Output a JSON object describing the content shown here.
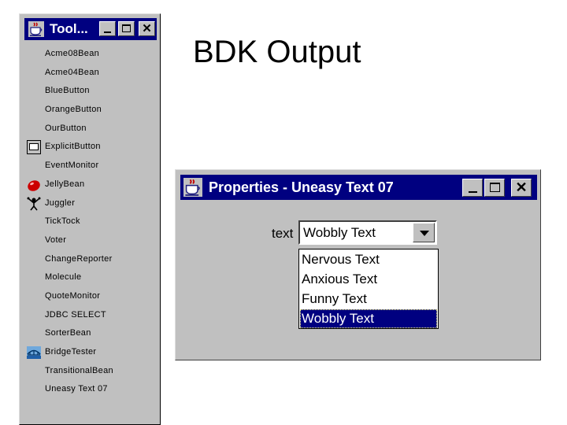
{
  "toolbox": {
    "title": "Tool...",
    "items": [
      {
        "label": "Acme08Bean",
        "icon": ""
      },
      {
        "label": "Acme04Bean",
        "icon": ""
      },
      {
        "label": "BlueButton",
        "icon": ""
      },
      {
        "label": "OrangeButton",
        "icon": ""
      },
      {
        "label": "OurButton",
        "icon": ""
      },
      {
        "label": "ExplicitButton",
        "icon": "button-icon"
      },
      {
        "label": "EventMonitor",
        "icon": ""
      },
      {
        "label": "JellyBean",
        "icon": "jellybean-icon"
      },
      {
        "label": "Juggler",
        "icon": "juggler-icon"
      },
      {
        "label": "TickTock",
        "icon": ""
      },
      {
        "label": "Voter",
        "icon": ""
      },
      {
        "label": "ChangeReporter",
        "icon": ""
      },
      {
        "label": "Molecule",
        "icon": ""
      },
      {
        "label": "QuoteMonitor",
        "icon": ""
      },
      {
        "label": "JDBC SELECT",
        "icon": ""
      },
      {
        "label": "SorterBean",
        "icon": ""
      },
      {
        "label": "BridgeTester",
        "icon": "bridge-icon"
      },
      {
        "label": "TransitionalBean",
        "icon": ""
      },
      {
        "label": "Uneasy Text 07",
        "icon": ""
      }
    ]
  },
  "heading": "BDK Output",
  "properties": {
    "title": "Properties - Uneasy Text 07",
    "field_label": "text",
    "selected_value": "Wobbly Text",
    "options": [
      "Nervous Text",
      "Anxious Text",
      "Funny Text",
      "Wobbly Text"
    ],
    "selected_index": 3
  },
  "colors": {
    "titlebar": "#000080",
    "window": "#c0c0c0",
    "selection": "#000080"
  },
  "icons": {
    "window_app": "java-cup-icon",
    "minimize": "minimize-icon",
    "maximize": "maximize-icon",
    "close": "close-icon",
    "dropdown": "chevron-down-icon"
  }
}
